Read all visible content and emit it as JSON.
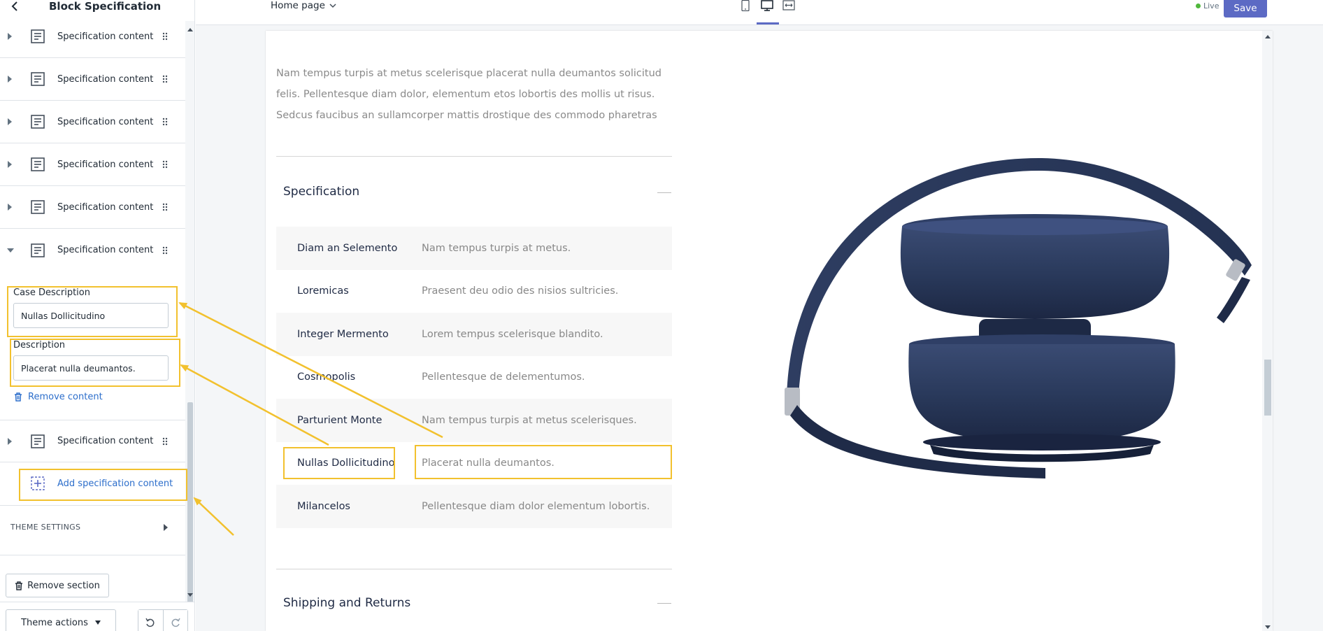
{
  "sidebar": {
    "title": "Block Specification",
    "collapsed_items": [
      {
        "label": "Specification content"
      },
      {
        "label": "Specification content"
      },
      {
        "label": "Specification content"
      },
      {
        "label": "Specification content"
      },
      {
        "label": "Specification content"
      }
    ],
    "expanded_item": {
      "label": "Specification content",
      "case_description_label": "Case Description",
      "case_description_value": "Nullas Dollicitudino",
      "description_label": "Description",
      "description_value": "Placerat nulla deumantos.",
      "remove_label": "Remove content"
    },
    "last_item": {
      "label": "Specification content"
    },
    "add_label": "Add specification content",
    "theme_settings_label": "THEME SETTINGS",
    "remove_section_label": "Remove section",
    "theme_actions_label": "Theme actions"
  },
  "topbar": {
    "page_select": "Home page",
    "live_label": "Live",
    "save_label": "Save"
  },
  "preview": {
    "intro": "Nam tempus turpis at metus scelerisque placerat nulla deumantos solicitud felis. Pellentesque diam dolor, elementum etos lobortis des mollis ut risus. Sedcus faucibus an sullamcorper mattis drostique des commodo pharetras",
    "specification_title": "Specification",
    "spec_rows": [
      {
        "key": "Diam an Selemento",
        "value": "Nam tempus turpis at metus."
      },
      {
        "key": "Loremicas",
        "value": "Praesent deu odio des nisios sultricies."
      },
      {
        "key": "Integer Mermento",
        "value": "Lorem tempus scelerisque blandito."
      },
      {
        "key": "Cosmopolis",
        "value": "Pellentesque de delementumos."
      },
      {
        "key": "Parturient Monte",
        "value": "Nam tempus turpis at metus scelerisques."
      },
      {
        "key": "Nullas Dollicitudino",
        "value": "Placerat nulla deumantos."
      },
      {
        "key": "Milancelos",
        "value": "Pellentesque diam dolor elementum lobortis."
      }
    ],
    "shipping_title": "Shipping and Returns"
  },
  "colors": {
    "accent": "#5c6ac4",
    "link": "#2c6ecb",
    "highlight": "#f2c12e",
    "live_dot": "#50b83c",
    "headphone_navy": "#2a3a5c"
  }
}
